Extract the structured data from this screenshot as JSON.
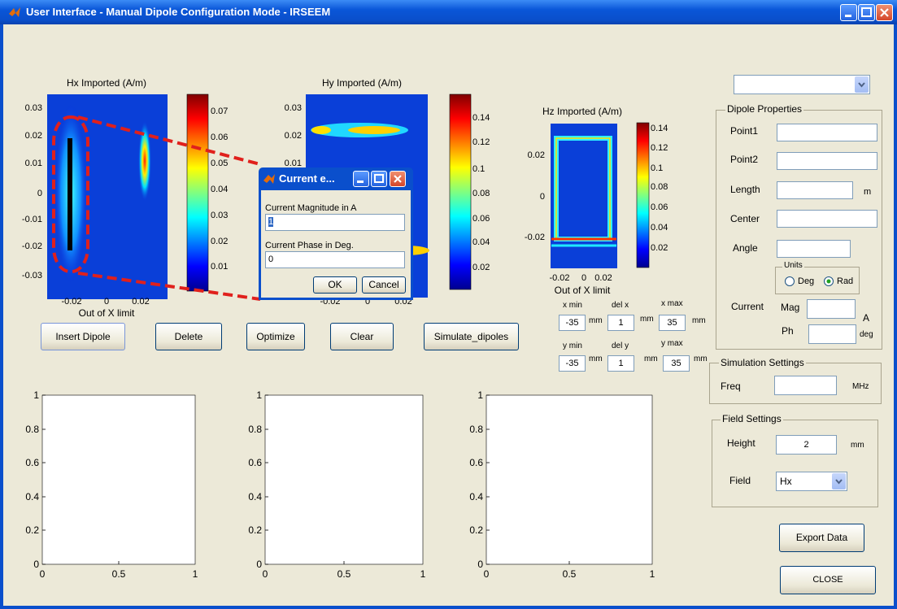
{
  "window": {
    "title": "User Interface - Manual Dipole Configuration Mode - IRSEEM"
  },
  "plots": {
    "hx": {
      "title": "Hx Imported (A/m)",
      "yticks": [
        "0.03",
        "0.02",
        "0.01",
        "0",
        "-0.01",
        "-0.02",
        "-0.03"
      ],
      "xticks": [
        "-0.02",
        "0",
        "0.02"
      ],
      "xlabel": "Out of X limit",
      "cbar_ticks": [
        "0.07",
        "0.06",
        "0.05",
        "0.04",
        "0.03",
        "0.02",
        "0.01"
      ]
    },
    "hy": {
      "title": "Hy Imported (A/m)",
      "yticks": [
        "0.03",
        "0.02",
        "0.01"
      ],
      "xticks": [
        "-0.02",
        "0",
        "0.02"
      ],
      "cbar_ticks": [
        "0.14",
        "0.12",
        "0.1",
        "0.08",
        "0.06",
        "0.04",
        "0.02"
      ]
    },
    "hz": {
      "title": "Hz Imported (A/m)",
      "yticks": [
        "0.02",
        "0",
        "-0.02"
      ],
      "xticks": [
        "-0.02",
        "0",
        "0.02"
      ],
      "xlabel": "Out of X limit",
      "cbar_ticks": [
        "0.14",
        "0.12",
        "0.1",
        "0.08",
        "0.06",
        "0.04",
        "0.02"
      ]
    }
  },
  "empty_axes": {
    "yticks": [
      "1",
      "0.8",
      "0.6",
      "0.4",
      "0.2",
      "0"
    ],
    "xticks": [
      "0",
      "0.5",
      "1"
    ]
  },
  "buttons": {
    "insert_dipole": "Insert Dipole",
    "delete": "Delete",
    "optimize": "Optimize",
    "clear": "Clear",
    "simulate": "Simulate_dipoles",
    "export": "Export Data",
    "close": "CLOSE"
  },
  "limits": {
    "x_min_label": "x min",
    "x_min": "-35",
    "del_x_label": "del x",
    "del_x": "1",
    "x_max_label": "x max",
    "x_max": "35",
    "y_min_label": "y min",
    "y_min": "-35",
    "del_y_label": "del y",
    "del_y": "1",
    "y_max_label": "y max",
    "y_max": "35",
    "unit": "mm"
  },
  "dipole_properties": {
    "title": "Dipole Properties",
    "point1": "Point1",
    "point2": "Point2",
    "length": "Length",
    "length_unit": "m",
    "center": "Center",
    "angle": "Angle",
    "units_title": "Units",
    "deg": "Deg",
    "rad": "Rad",
    "current": "Current",
    "mag": "Mag",
    "mag_unit": "A",
    "ph": "Ph",
    "ph_unit": "deg"
  },
  "simulation_settings": {
    "title": "Simulation Settings",
    "freq": "Freq",
    "freq_unit": "MHz"
  },
  "field_settings": {
    "title": "Field Settings",
    "height": "Height",
    "height_value": "2",
    "height_unit": "mm",
    "field": "Field",
    "field_value": "Hx"
  },
  "dialog": {
    "title": "Current e...",
    "magnitude_label": "Current Magnitude in A",
    "magnitude_value": "1",
    "phase_label": "Current Phase in Deg.",
    "phase_value": "0",
    "ok": "OK",
    "cancel": "Cancel"
  },
  "colors": {
    "titlebar": "#0a4fcc",
    "background": "#ece9d8",
    "annotation": "#e0201c"
  }
}
